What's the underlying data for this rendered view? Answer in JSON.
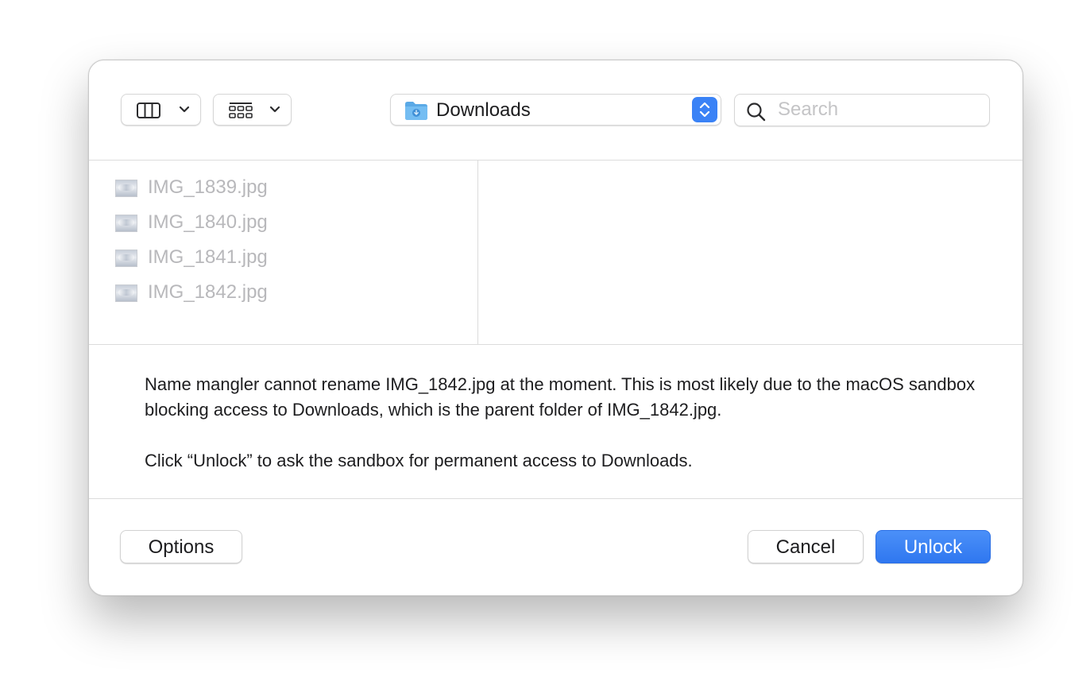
{
  "toolbar": {
    "view_mode_icon": "column-view-icon",
    "group_mode_icon": "icon-grid-icon",
    "location": {
      "label": "Downloads",
      "icon": "downloads-folder-icon",
      "accent_color": "#3a82f6"
    },
    "search": {
      "placeholder": "Search",
      "value": ""
    }
  },
  "browser": {
    "files": [
      {
        "name": "IMG_1839.jpg",
        "icon": "image-file-icon"
      },
      {
        "name": "IMG_1840.jpg",
        "icon": "image-file-icon"
      },
      {
        "name": "IMG_1841.jpg",
        "icon": "image-file-icon"
      },
      {
        "name": "IMG_1842.jpg",
        "icon": "image-file-icon"
      }
    ]
  },
  "message": {
    "paragraph1": "Name mangler cannot rename IMG_1842.jpg at the moment. This is most likely due to the macOS sandbox blocking access to Downloads, which is the parent folder of IMG_1842.jpg.",
    "paragraph2": "Click “Unlock” to ask the sandbox for permanent access to Downloads."
  },
  "footer": {
    "options_label": "Options",
    "cancel_label": "Cancel",
    "unlock_label": "Unlock",
    "primary_color": "#3a82f6"
  }
}
